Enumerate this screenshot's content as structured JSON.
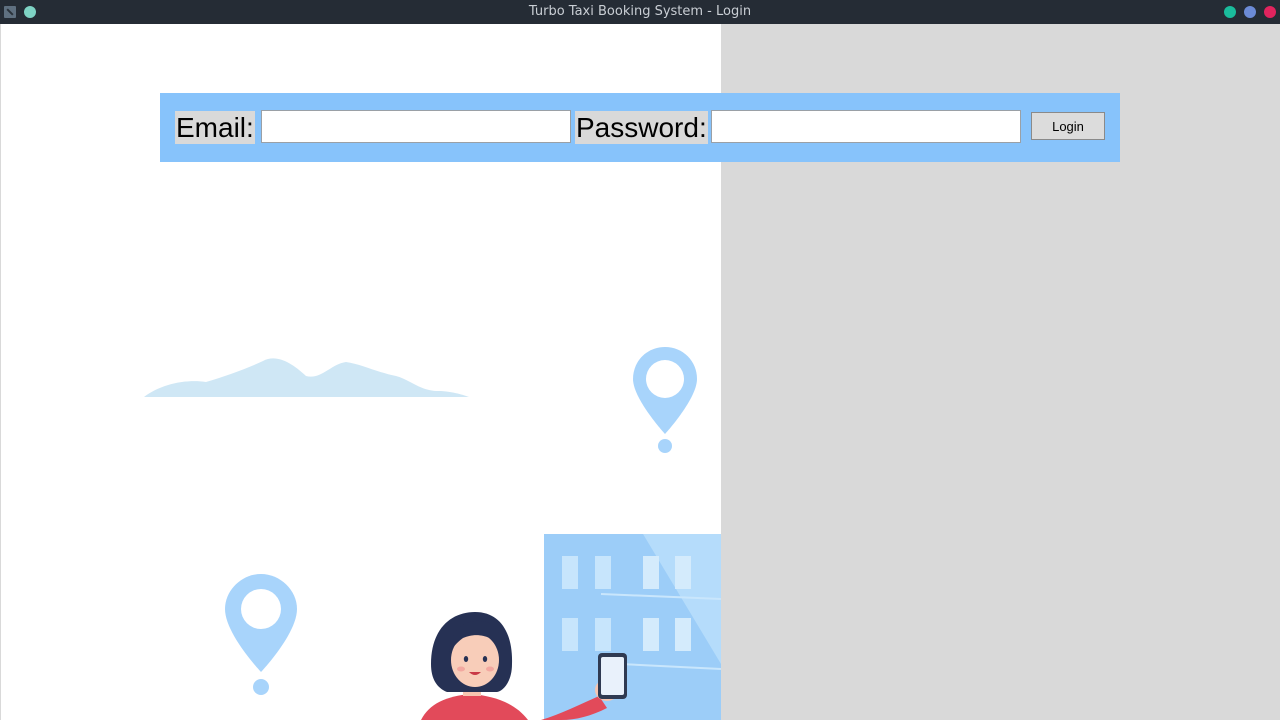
{
  "window": {
    "title": "Turbo Taxi Booking System - Login",
    "controls": {
      "minimize_color": "#1abc9c",
      "maximize_color": "#6c8bd6",
      "close_color": "#e0245e"
    }
  },
  "login_form": {
    "email_label": "Email:",
    "email_value": "",
    "password_label": "Password:",
    "password_value": "",
    "login_button": "Login",
    "bar_color": "#87c3fb"
  },
  "illustration": {
    "elements": [
      "cloud",
      "location-pin-icon",
      "location-pin-icon",
      "building",
      "woman-with-phone"
    ],
    "accent_color": "#a9d3fb"
  }
}
